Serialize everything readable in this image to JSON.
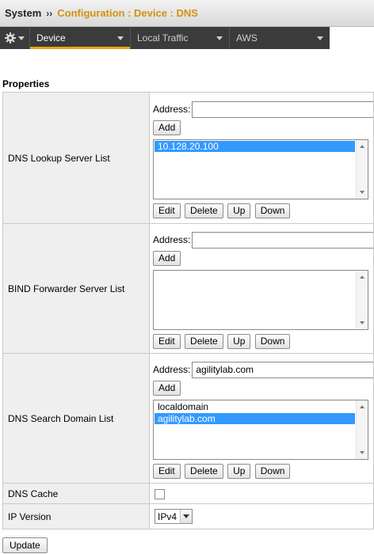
{
  "breadcrumb": {
    "system": "System",
    "separator": "››",
    "path": "Configuration : Device : DNS"
  },
  "menubar": {
    "gear_icon": "gear-icon",
    "tabs": [
      {
        "label": "Device",
        "active": true
      },
      {
        "label": "Local Traffic",
        "active": false
      },
      {
        "label": "AWS",
        "active": false
      }
    ]
  },
  "colors": {
    "accent": "#e8a317",
    "path_text": "#d4910e",
    "selection": "#3399ff",
    "menubar_bg": "#3b3b3b"
  },
  "section_title": "Properties",
  "properties": {
    "dns_lookup": {
      "label": "DNS Lookup Server List",
      "address_label": "Address:",
      "address_value": "",
      "add_label": "Add",
      "items": [
        {
          "text": "10.128.20.100",
          "selected": true
        }
      ],
      "edit_label": "Edit",
      "delete_label": "Delete",
      "up_label": "Up",
      "down_label": "Down"
    },
    "bind_forwarder": {
      "label": "BIND Forwarder Server List",
      "address_label": "Address:",
      "address_value": "",
      "add_label": "Add",
      "items": [],
      "edit_label": "Edit",
      "delete_label": "Delete",
      "up_label": "Up",
      "down_label": "Down"
    },
    "dns_search": {
      "label": "DNS Search Domain List",
      "address_label": "Address:",
      "address_value": "agilitylab.com",
      "add_label": "Add",
      "items": [
        {
          "text": "localdomain",
          "selected": false
        },
        {
          "text": "agilitylab.com",
          "selected": true
        }
      ],
      "edit_label": "Edit",
      "delete_label": "Delete",
      "up_label": "Up",
      "down_label": "Down"
    },
    "dns_cache": {
      "label": "DNS Cache",
      "checked": false
    },
    "ip_version": {
      "label": "IP Version",
      "selected": "IPv4"
    }
  },
  "update_label": "Update"
}
